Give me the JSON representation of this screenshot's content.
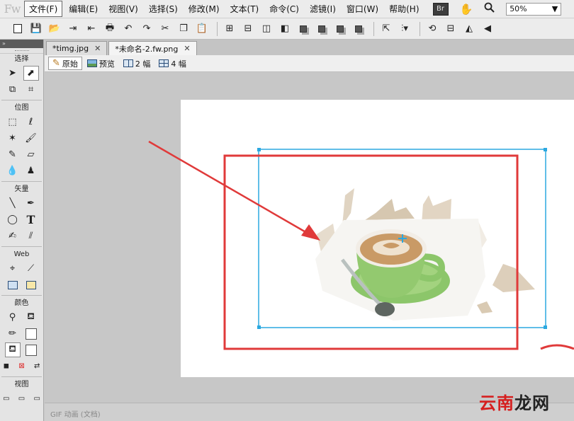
{
  "app": {
    "logo_text": "Fw"
  },
  "menu": {
    "items": [
      "文件(F)",
      "编辑(E)",
      "视图(V)",
      "选择(S)",
      "修改(M)",
      "文本(T)",
      "命令(C)",
      "滤镜(I)",
      "窗口(W)",
      "帮助(H)"
    ],
    "bridge_badge": "Br",
    "zoom_value": "50%"
  },
  "toolbar": {
    "icons": [
      "new-document",
      "save",
      "open",
      "import",
      "export",
      "print",
      "undo",
      "redo",
      "cut",
      "copy",
      "paste",
      "group",
      "ungroup",
      "join",
      "split",
      "bring-forward",
      "send-backward",
      "arrange-front",
      "arrange-back",
      "align",
      "align-menu",
      "rotate",
      "distribute",
      "flip-horizontal",
      "flip-vertical"
    ]
  },
  "tools_panel": {
    "sections": {
      "select": "选择",
      "bitmap": "位图",
      "vector": "矢量",
      "web": "Web",
      "colors": "颜色",
      "view": "视图"
    }
  },
  "tabs": [
    {
      "label": "*timg.jpg",
      "active": false
    },
    {
      "label": "*未命名-2.fw.png",
      "active": true
    }
  ],
  "view_modes": [
    {
      "label": "原始",
      "icon": "pencil-icon",
      "active": true
    },
    {
      "label": "预览",
      "icon": "preview-icon",
      "active": false
    },
    {
      "label": "2 幅",
      "icon": "split2-icon",
      "active": false
    },
    {
      "label": "4 幅",
      "icon": "split4-icon",
      "active": false
    }
  ],
  "status": {
    "text": "GIF 动画 (文档)"
  },
  "watermark": {
    "part1": "云南",
    "part2": "龙网"
  },
  "colors": {
    "annotation_red": "#e03a3a",
    "selection_blue": "#2ba8e0",
    "cup_green": "#8cc66a",
    "canvas": "#ffffff"
  }
}
